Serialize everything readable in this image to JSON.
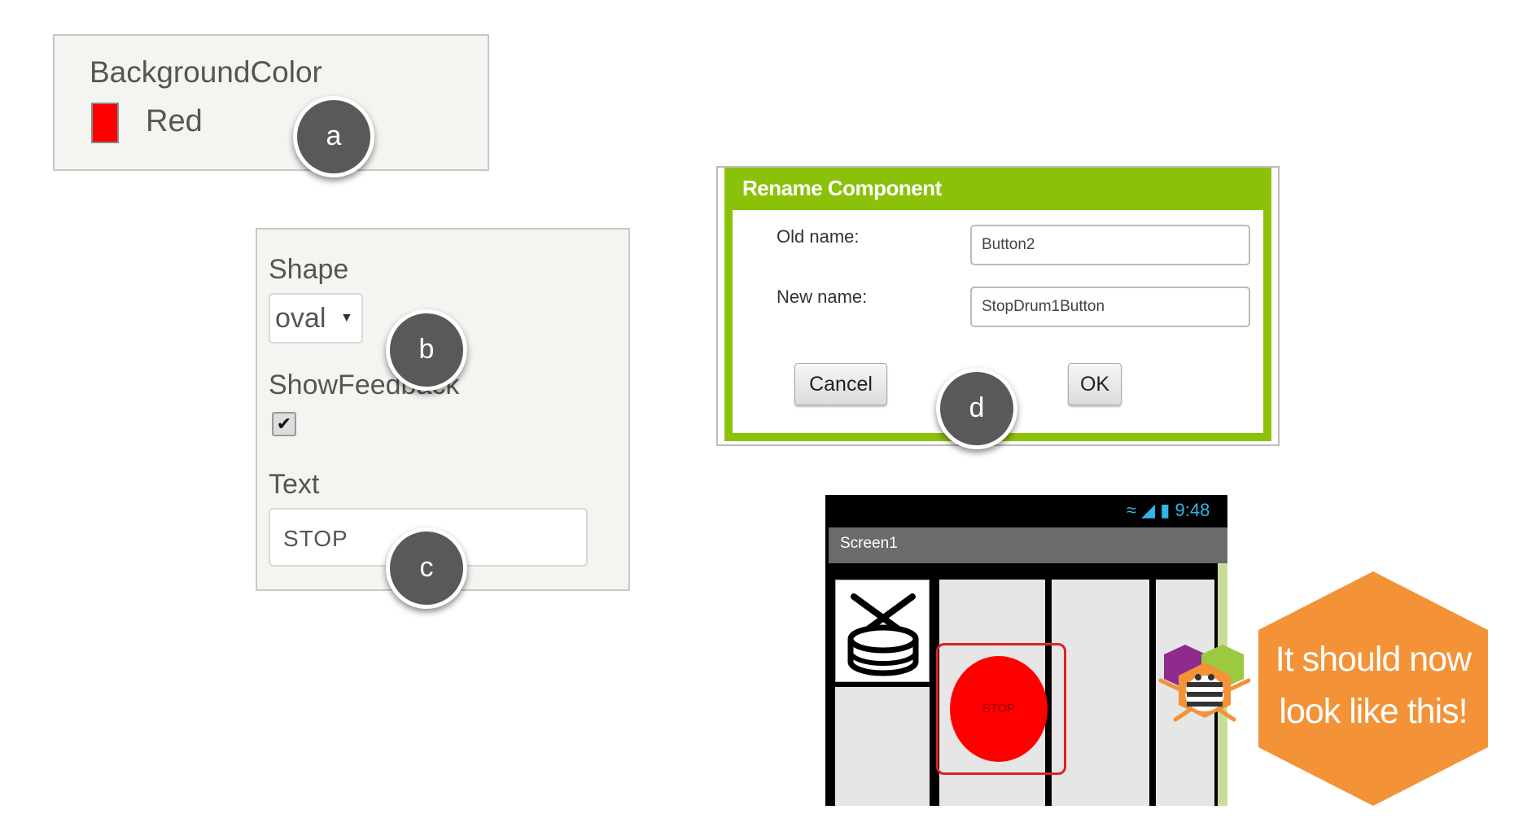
{
  "background_color_panel": {
    "label": "BackgroundColor",
    "swatch_color": "#ff0000",
    "value": "Red",
    "marker": "a"
  },
  "button_props_panel": {
    "shape_label": "Shape",
    "shape_value": "oval",
    "shape_marker": "b",
    "show_feedback_label": "ShowFeedback",
    "show_feedback_checked": true,
    "text_label": "Text",
    "text_value": "STOP",
    "text_marker": "c"
  },
  "rename_dialog": {
    "title": "Rename Component",
    "old_name_label": "Old name:",
    "old_name_value": "Button2",
    "new_name_label": "New name:",
    "new_name_value": "StopDrum1Button",
    "cancel_label": "Cancel",
    "ok_label": "OK",
    "marker": "d",
    "accent_color": "#8cc10a"
  },
  "phone_preview": {
    "status_time": "9:48",
    "screen_title": "Screen1",
    "stop_button_text": "STOP",
    "stop_button_color": "#ff0000"
  },
  "callout": {
    "text_line1": "It should now",
    "text_line2": "look like this!",
    "color": "#f39237"
  },
  "icons": [
    "drum-icon",
    "wifi-icon",
    "signal-icon",
    "battery-icon",
    "checkmark-icon",
    "dropdown-caret-icon",
    "app-inventor-mascot-icon"
  ]
}
